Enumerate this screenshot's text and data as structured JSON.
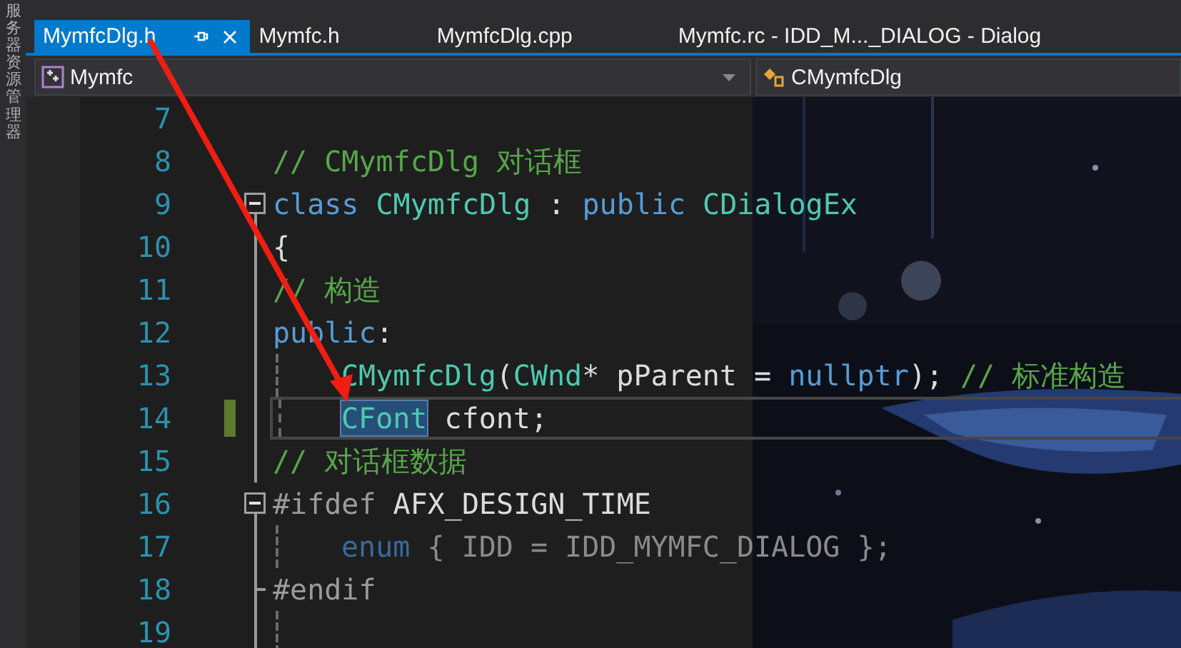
{
  "side_panel": {
    "label": "服务器资源管理器"
  },
  "tabs": [
    {
      "label": "MymfcDlg.h",
      "selected": true
    },
    {
      "label": "Mymfc.h",
      "selected": false
    },
    {
      "label": "MymfcDlg.cpp",
      "selected": false
    },
    {
      "label": "Mymfc.rc - IDD_M..._DIALOG - Dialog",
      "selected": false
    }
  ],
  "navigation": {
    "project": "Mymfc",
    "scope": "CMymfcDlg"
  },
  "editor": {
    "lines": [
      {
        "number": "7",
        "fold_start": false,
        "fold_end": false,
        "indented": false,
        "changed": false,
        "current": false
      },
      {
        "number": "8",
        "fold_start": false,
        "fold_end": false,
        "indented": false,
        "changed": false,
        "current": false,
        "tokens": [
          {
            "text": "// CMymfcDlg 对话框",
            "kind": "comment",
            "selected": false
          }
        ]
      },
      {
        "number": "9",
        "fold_start": true,
        "fold_end": false,
        "indented": false,
        "changed": false,
        "current": false,
        "tokens": [
          {
            "text": "class ",
            "kind": "keyword",
            "selected": false
          },
          {
            "text": "CMymfcDlg",
            "kind": "type",
            "selected": false
          },
          {
            "text": " : ",
            "kind": "plain",
            "selected": false
          },
          {
            "text": "public ",
            "kind": "keyword",
            "selected": false
          },
          {
            "text": "CDialogEx",
            "kind": "type",
            "selected": false
          }
        ]
      },
      {
        "number": "10",
        "fold_start": false,
        "fold_end": false,
        "indented": false,
        "changed": false,
        "current": false,
        "tokens": [
          {
            "text": "{",
            "kind": "plain",
            "selected": false
          }
        ]
      },
      {
        "number": "11",
        "fold_start": false,
        "fold_end": false,
        "indented": false,
        "changed": false,
        "current": false,
        "tokens": [
          {
            "text": "// 构造",
            "kind": "comment",
            "selected": false
          }
        ]
      },
      {
        "number": "12",
        "fold_start": false,
        "fold_end": false,
        "indented": false,
        "changed": false,
        "current": false,
        "tokens": [
          {
            "text": "public",
            "kind": "keyword",
            "selected": false
          },
          {
            "text": ":",
            "kind": "plain",
            "selected": false
          }
        ]
      },
      {
        "number": "13",
        "fold_start": false,
        "fold_end": false,
        "indented": true,
        "changed": false,
        "current": false,
        "tokens": [
          {
            "text": "CMymfcDlg",
            "kind": "type",
            "selected": false
          },
          {
            "text": "(",
            "kind": "plain",
            "selected": false
          },
          {
            "text": "CWnd",
            "kind": "type",
            "selected": false
          },
          {
            "text": "* pParent = ",
            "kind": "plain",
            "selected": false
          },
          {
            "text": "nullptr",
            "kind": "keyword",
            "selected": false
          },
          {
            "text": "); ",
            "kind": "plain",
            "selected": false
          },
          {
            "text": "// 标准构造",
            "kind": "comment",
            "selected": false
          }
        ]
      },
      {
        "number": "14",
        "fold_start": false,
        "fold_end": false,
        "indented": true,
        "changed": true,
        "current": true,
        "tokens": [
          {
            "text": "CFont",
            "kind": "type",
            "selected": true
          },
          {
            "text": " cfont;",
            "kind": "plain",
            "selected": false
          }
        ]
      },
      {
        "number": "15",
        "fold_start": false,
        "fold_end": false,
        "indented": false,
        "changed": false,
        "current": false,
        "tokens": [
          {
            "text": "// 对话框数据",
            "kind": "comment",
            "selected": false
          }
        ]
      },
      {
        "number": "16",
        "fold_start": true,
        "fold_end": false,
        "indented": false,
        "changed": false,
        "current": false,
        "tokens": [
          {
            "text": "#ifdef",
            "kind": "preprocessor",
            "selected": false
          },
          {
            "text": " AFX_DESIGN_TIME",
            "kind": "plain",
            "selected": false
          }
        ]
      },
      {
        "number": "17",
        "fold_start": false,
        "fold_end": false,
        "indented": true,
        "changed": false,
        "current": false,
        "tokens": [
          {
            "text": "enum",
            "kind": "inactive-keyword",
            "selected": false
          },
          {
            "text": " { IDD = IDD_MYMFC_DIALOG };",
            "kind": "inactive",
            "selected": false
          }
        ]
      },
      {
        "number": "18",
        "fold_start": false,
        "fold_end": true,
        "indented": false,
        "changed": false,
        "current": false,
        "tokens": [
          {
            "text": "#endif",
            "kind": "preprocessor",
            "selected": false
          }
        ]
      },
      {
        "number": "19",
        "fold_start": false,
        "fold_end": false,
        "indented": true,
        "changed": false,
        "current": false
      }
    ]
  }
}
